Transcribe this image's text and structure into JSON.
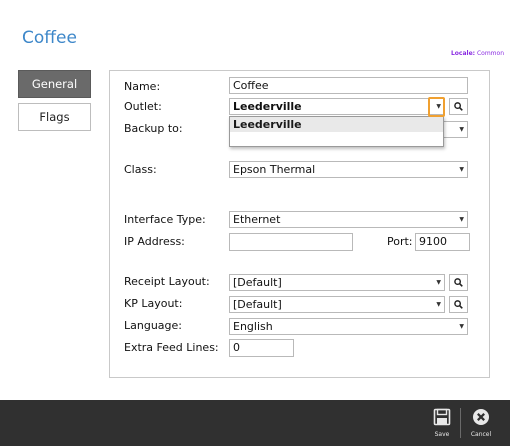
{
  "page": {
    "title": "Coffee"
  },
  "locale": {
    "label": "Locale:",
    "value": "Common"
  },
  "tabs": [
    {
      "label": "General",
      "active": true
    },
    {
      "label": "Flags",
      "active": false
    }
  ],
  "form": {
    "name": {
      "label": "Name:",
      "value": "Coffee"
    },
    "outlet": {
      "label": "Outlet:",
      "value": "Leederville"
    },
    "backup": {
      "label": "Backup to:",
      "value": ""
    },
    "class": {
      "label": "Class:",
      "value": "Epson Thermal"
    },
    "interface_type": {
      "label": "Interface Type:",
      "value": "Ethernet"
    },
    "ip_address": {
      "label": "IP Address:",
      "value": ""
    },
    "port": {
      "label": "Port:",
      "value": "9100"
    },
    "receipt_layout": {
      "label": "Receipt Layout:",
      "value": "[Default]"
    },
    "kp_layout": {
      "label": "KP Layout:",
      "value": "[Default]"
    },
    "language": {
      "label": "Language:",
      "value": "English"
    },
    "extra_feed_lines": {
      "label": "Extra Feed Lines:",
      "value": "0"
    }
  },
  "dropdown": {
    "options": [
      "Leederville"
    ]
  },
  "footer": {
    "save_label": "Save",
    "cancel_label": "Cancel"
  },
  "colors": {
    "title": "#3d87c9",
    "locale": "#8a2be2",
    "highlight": "#f0a030",
    "footer": "#303030"
  },
  "icons": {
    "search": "search-icon",
    "save": "floppy-disk-icon",
    "cancel": "close-circle-icon",
    "dropdown": "chevron-down-icon"
  }
}
